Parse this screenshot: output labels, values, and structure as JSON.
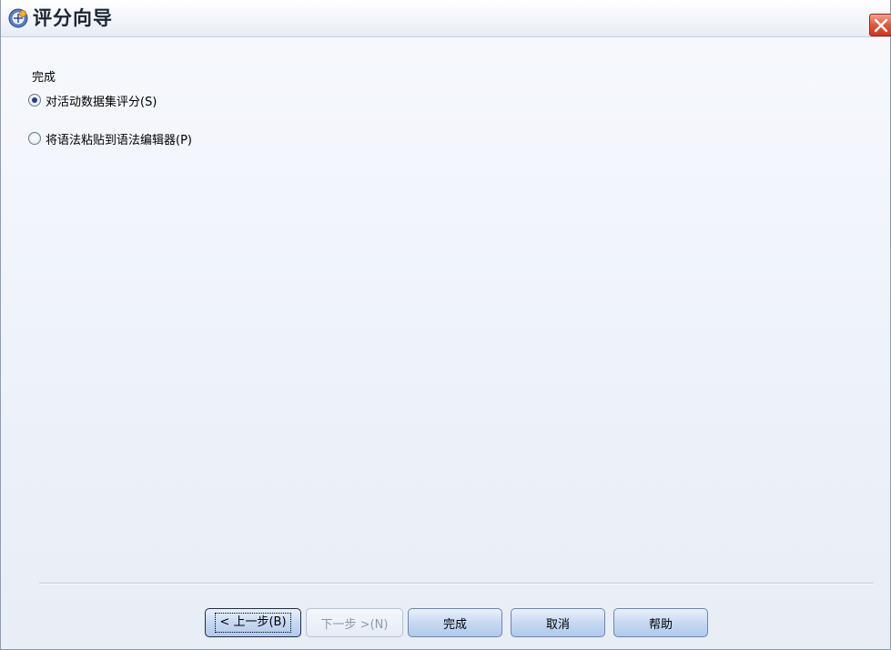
{
  "window": {
    "title": "评分向导"
  },
  "content": {
    "section_label": "完成",
    "options": [
      {
        "label": "对活动数据集评分(S)",
        "selected": true
      },
      {
        "label": "将语法粘贴到语法编辑器(P)",
        "selected": false
      }
    ]
  },
  "buttons": {
    "back": "< 上一步(B)",
    "next": "下一步 >(N)",
    "finish": "完成",
    "cancel": "取消",
    "help": "帮助"
  },
  "icons": {
    "app": "wizard-app-icon",
    "close": "close-icon"
  }
}
